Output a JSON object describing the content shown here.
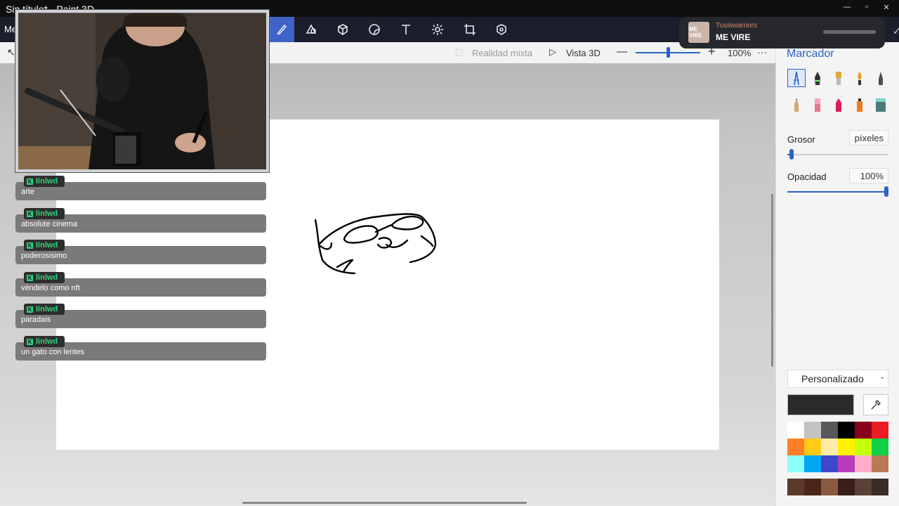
{
  "window": {
    "title": "Sin título* - Paint 3D",
    "controls": [
      "minimize-icon",
      "maximize-icon",
      "close-icon"
    ]
  },
  "menu": {
    "label": "Me"
  },
  "toolbar": {
    "active_tool": "brushes",
    "tools": [
      "brush-icon",
      "shapes-2d-icon",
      "shapes-3d-icon",
      "stickers-icon",
      "text-icon",
      "effects-icon",
      "crop-icon",
      "library-3d-icon"
    ]
  },
  "subbar": {
    "mixed_reality": "Realidad mixta",
    "view_3d": "Vista 3D",
    "zoom": "100%",
    "more": "···"
  },
  "panel": {
    "title": "Marcador",
    "thickness_label": "Grosor",
    "thickness_value": "píxeles",
    "opacity_label": "Opacidad",
    "opacity_value": "100%",
    "opacity_level": 1.0,
    "thickness_level": 0.02,
    "color_mode": "Personalizado",
    "current_color": "#2a2a2a",
    "palette": [
      "#ffffff",
      "#c3c3c3",
      "#585858",
      "#000000",
      "#88001b",
      "#ec1c24",
      "#ff7f27",
      "#ffca18",
      "#fdeca6",
      "#fff200",
      "#c4ff0e",
      "#0ed145",
      "#8cfffb",
      "#00a8f3",
      "#3f48cc",
      "#b83dba",
      "#ffaec8",
      "#b97a56"
    ],
    "custom_swatches": [
      "#5b3a2a",
      "#4a2618",
      "#8a5a40",
      "#3a1e16",
      "#5a4038",
      "#3a2c26"
    ],
    "accent": "#2a62c9"
  },
  "music": {
    "artist": "Tussiwarriors",
    "track": "ME VIRE",
    "cover_text": "ME VIRE"
  },
  "chat": [
    {
      "user": "linlwd",
      "message": "arte"
    },
    {
      "user": "linlwd",
      "message": "absolute cinema"
    },
    {
      "user": "linlwd",
      "message": "poderosisimo"
    },
    {
      "user": "linlwd",
      "message": "véndelo como nft"
    },
    {
      "user": "linlwd",
      "message": "paradais"
    },
    {
      "user": "linlwd",
      "message": "un gato con lentes"
    }
  ]
}
